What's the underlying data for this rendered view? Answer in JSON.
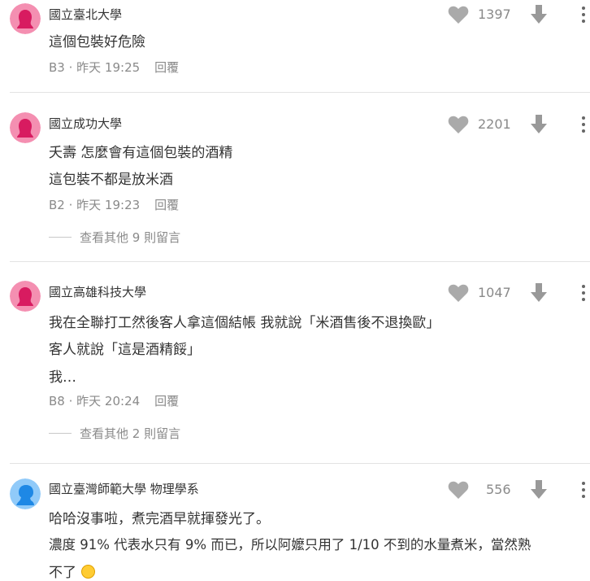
{
  "comments": [
    {
      "author": "國立臺北大學",
      "lines": [
        "這個包裝好危險"
      ],
      "floor": "B3",
      "time": "昨天 19:25",
      "reply_label": "回覆",
      "likes": "1397",
      "avatar_color": "#f06292"
    },
    {
      "author": "國立成功大學",
      "lines": [
        "夭壽 怎麼會有這個包裝的酒精",
        "這包裝不都是放米酒"
      ],
      "floor": "B2",
      "time": "昨天 19:23",
      "reply_label": "回覆",
      "likes": "2201",
      "more_replies": "查看其他 9 則留言",
      "avatar_color": "#f06292"
    },
    {
      "author": "國立高雄科技大學",
      "lines": [
        "我在全聯打工然後客人拿這個結帳 我就說「米酒售後不退換歐」",
        "客人就說「這是酒精餒」",
        "我…"
      ],
      "floor": "B8",
      "time": "昨天 20:24",
      "reply_label": "回覆",
      "likes": "1047",
      "more_replies": "查看其他 2 則留言",
      "avatar_color": "#f06292"
    },
    {
      "author": "國立臺灣師範大學 物理學系",
      "lines": [
        "哈哈沒事啦，煮完酒早就揮發光了。",
        "濃度 91% 代表水只有 9% 而已，所以阿嬤只用了 1/10 不到的水量煮米，當然熟",
        "不了"
      ],
      "likes": "556",
      "avatar_color": "#4aa8e8",
      "emoji_icon": "laughing-emoji-icon"
    }
  ],
  "icons": {
    "like": "heart-icon",
    "dislike": "arrow-down-icon",
    "more": "more-vertical-icon"
  }
}
